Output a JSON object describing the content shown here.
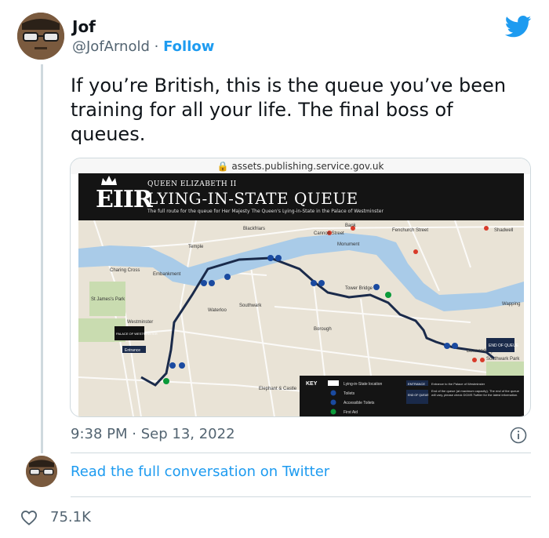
{
  "author": {
    "name": "Jof",
    "handle": "@JofArnold",
    "separator": "·",
    "follow_label": "Follow"
  },
  "tweet": {
    "text": "If you’re British, this is the queue you’ve been training for all your life. The final boss of queues."
  },
  "card": {
    "url": "assets.publishing.service.gov.uk",
    "crest": "EIIR",
    "header_small": "QUEEN ELIZABETH II",
    "header_title": "LYING-IN-STATE QUEUE",
    "header_sub": "The full route for the queue for Her Majesty The Queen's Lying-in-State in the Palace of Westminster",
    "labels": {
      "st_james_park": "St James's Park",
      "westminster": "Westminster",
      "tower_bridge": "Tower Bridge",
      "southwark_park": "Southwark Park",
      "bermondsey": "Bermondsey",
      "elephant_castle": "Elephant & Castle",
      "borough": "Borough",
      "bank": "Bank",
      "cannon_street": "Cannon Street",
      "fenchurch_street": "Fenchurch Street",
      "monument": "Monument",
      "waterloo": "Waterloo",
      "southwark": "Southwark",
      "temple": "Temple",
      "embankment": "Embankment",
      "blackfriars": "Blackfriars",
      "charing_cross": "Charing Cross",
      "shadwell": "Shadwell",
      "wapping": "Wapping",
      "palace": "PALACE OF WESTMINSTER",
      "entrance": "Entrance",
      "end_of_queue": "END OF QUEUE"
    },
    "key": {
      "title": "KEY",
      "items": [
        "Lying-in-State location",
        "Toilets",
        "Accessible Toilets",
        "First Aid"
      ],
      "entrance_badge": "ENTRANCE",
      "entrance_text": "Entrance to the Palace of Westminster",
      "end_badge": "END OF QUEUE",
      "end_text": "End of the queue (at maximum capacity). The end of the queue will vary, please check DCMS Twitter for the latest information."
    }
  },
  "meta": {
    "time": "9:38 PM",
    "separator": "·",
    "date": "Sep 13, 2022"
  },
  "read_full_label": "Read the full conversation on Twitter",
  "likes": "75.1K",
  "colors": {
    "link": "#1d9bf0",
    "secondary": "#536471",
    "route": "#1a2a4a",
    "river": "#a9cbe8",
    "land": "#e9e3d6"
  }
}
